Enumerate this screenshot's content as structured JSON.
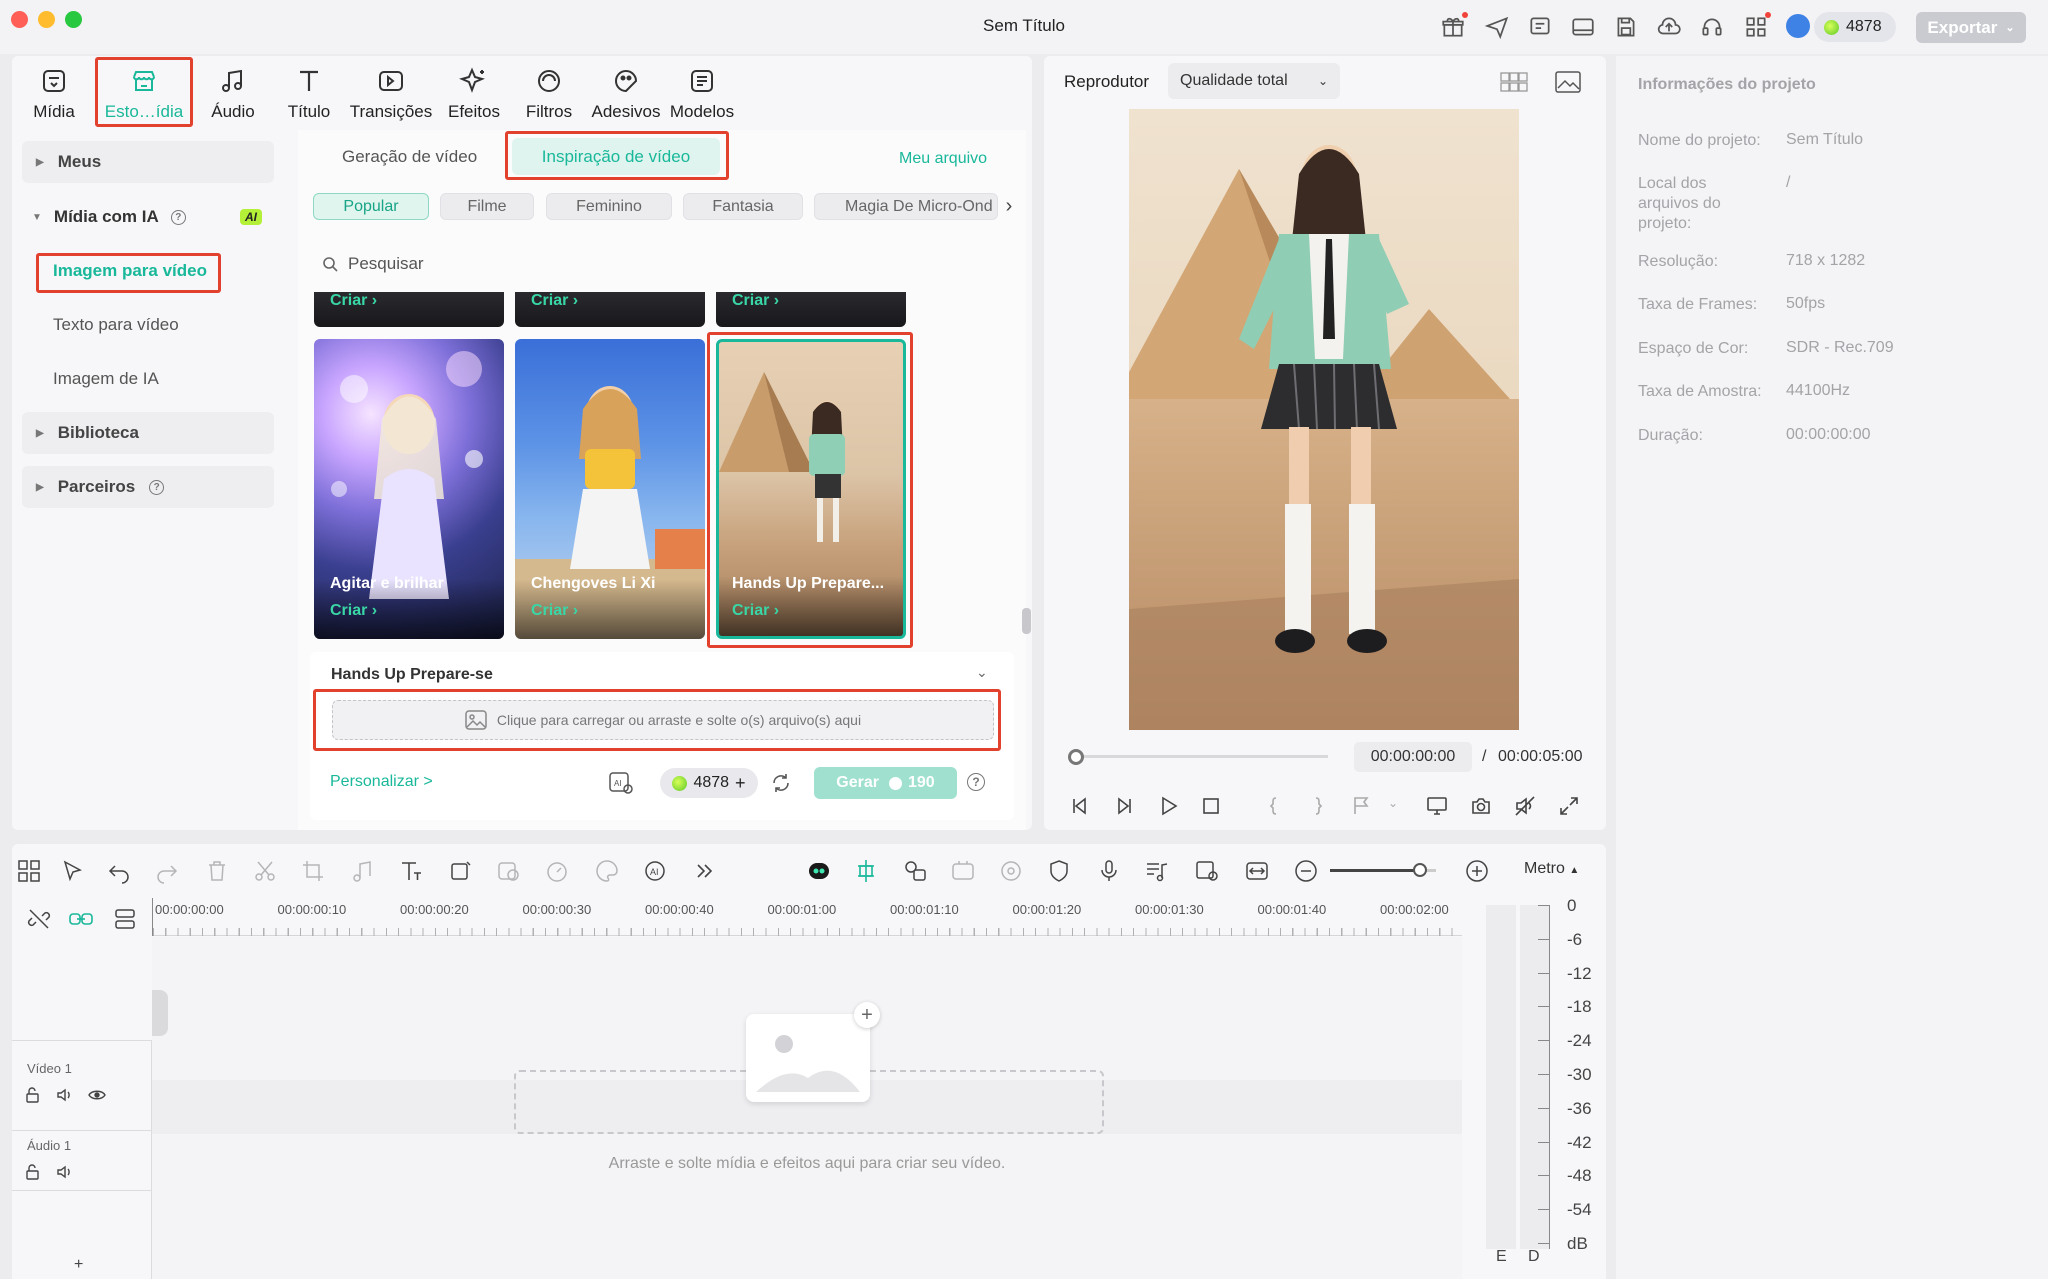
{
  "window": {
    "title": "Sem Título"
  },
  "topbar": {
    "credits": "4878",
    "export_label": "Exportar"
  },
  "tooltabs": [
    {
      "label": "Mídia"
    },
    {
      "label": "Esto…ídia"
    },
    {
      "label": "Áudio"
    },
    {
      "label": "Título"
    },
    {
      "label": "Transições"
    },
    {
      "label": "Efeitos"
    },
    {
      "label": "Filtros"
    },
    {
      "label": "Adesivos"
    },
    {
      "label": "Modelos"
    }
  ],
  "sidebar": {
    "meus": "Meus",
    "midia_ia": "Mídia com IA",
    "ai_badge": "AI",
    "items": [
      "Imagem para vídeo",
      "Texto para vídeo",
      "Imagem de IA"
    ],
    "biblioteca": "Biblioteca",
    "parceiros": "Parceiros"
  },
  "subtabs": {
    "geracao": "Geração de vídeo",
    "inspiracao": "Inspiração de vídeo",
    "meu_arquivo": "Meu arquivo"
  },
  "chips": [
    "Popular",
    "Filme",
    "Feminino",
    "Fantasia",
    "Magia De Micro-Ond"
  ],
  "search": {
    "placeholder": "Pesquisar"
  },
  "criar": "Criar",
  "cards": [
    {
      "title": "Agitar e brilhar",
      "cta": "Criar"
    },
    {
      "title": "Chengoves Li Xi",
      "cta": "Criar"
    },
    {
      "title": "Hands Up Prepare...",
      "cta": "Criar"
    }
  ],
  "detail": {
    "title": "Hands Up Prepare-se",
    "upload_text": "Clique para carregar ou arraste e solte o(s) arquivo(s) aqui",
    "personalizar": "Personalizar >",
    "credits": "4878",
    "gerar_label": "Gerar",
    "gerar_cost": "190"
  },
  "player": {
    "title": "Reprodutor",
    "quality": "Qualidade total",
    "current_time": "00:00:00:00",
    "separator": "/",
    "total_time": "00:00:05:00"
  },
  "info": {
    "title": "Informações do projeto",
    "rows": [
      {
        "label": "Nome do projeto:",
        "value": "Sem Título"
      },
      {
        "label": "Local dos arquivos do projeto:",
        "value": "/"
      },
      {
        "label": "Resolução:",
        "value": "718 x 1282"
      },
      {
        "label": "Taxa de Frames:",
        "value": "50fps"
      },
      {
        "label": "Espaço de Cor:",
        "value": "SDR - Rec.709"
      },
      {
        "label": "Taxa de Amostra:",
        "value": "44100Hz"
      },
      {
        "label": "Duração:",
        "value": "00:00:00:00"
      }
    ]
  },
  "timeline": {
    "metro_label": "Metro",
    "ruler": [
      "00:00:00:00",
      "00:00:00:10",
      "00:00:00:20",
      "00:00:00:30",
      "00:00:00:40",
      "00:00:01:00",
      "00:00:01:10",
      "00:00:01:20",
      "00:00:01:30",
      "00:00:01:40",
      "00:00:02:00"
    ],
    "video_track": "Vídeo 1",
    "audio_track": "Áudio 1",
    "drop_hint": "Arraste e solte mídia e efeitos aqui para criar seu vídeo.",
    "add_track": "+",
    "zoom_level": 0.85
  },
  "meter": {
    "labels": [
      "0",
      "-6",
      "-12",
      "-18",
      "-24",
      "-30",
      "-36",
      "-42",
      "-48",
      "-54",
      "dB"
    ],
    "channels": [
      "E",
      "D"
    ]
  },
  "colors": {
    "accent": "#19b89a",
    "highlight": "#e2412e"
  }
}
